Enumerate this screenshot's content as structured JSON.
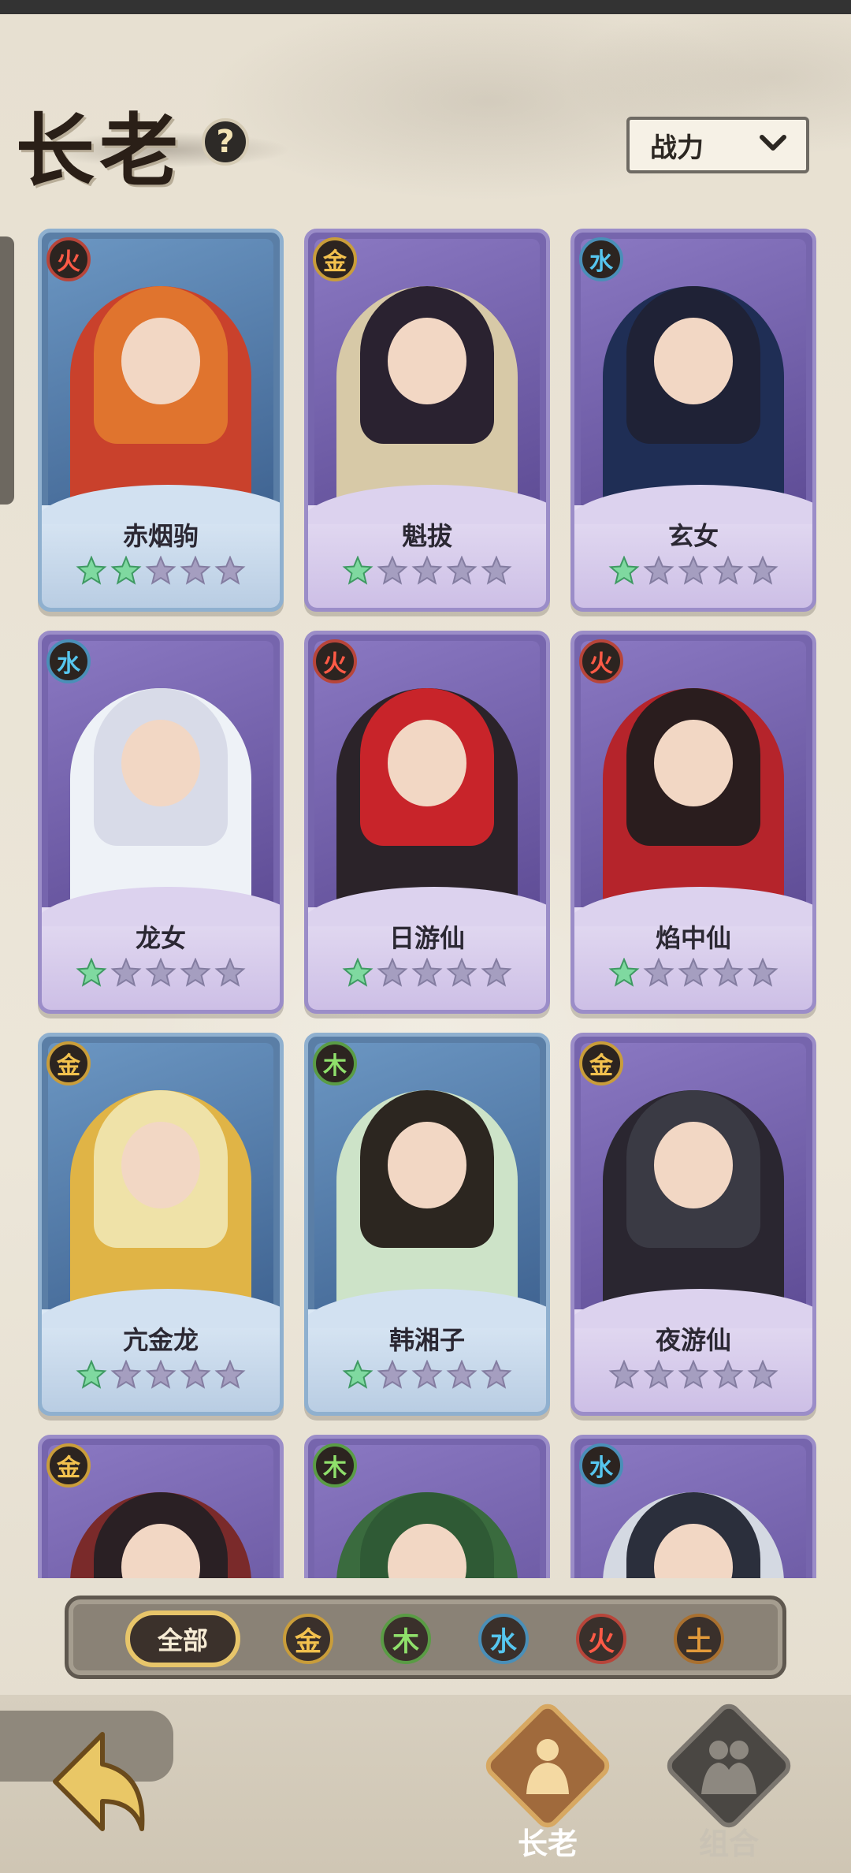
{
  "header": {
    "title": "长老",
    "sort_label": "战力"
  },
  "colors": {
    "fire": "#ff5a46",
    "metal": "#f2c14e",
    "water": "#56c6ef",
    "wood": "#8fe06b",
    "earth": "#e39a3a",
    "star_filled": "#7fd9a0",
    "star_empty": "#a59ec0"
  },
  "heroes": [
    {
      "name": "赤烟驹",
      "element": "火",
      "stars": 2,
      "theme": "blue"
    },
    {
      "name": "魁拔",
      "element": "金",
      "stars": 1,
      "theme": "purple"
    },
    {
      "name": "玄女",
      "element": "水",
      "stars": 1,
      "theme": "purple"
    },
    {
      "name": "龙女",
      "element": "水",
      "stars": 1,
      "theme": "purple"
    },
    {
      "name": "日游仙",
      "element": "火",
      "stars": 1,
      "theme": "purple"
    },
    {
      "name": "焰中仙",
      "element": "火",
      "stars": 1,
      "theme": "purple"
    },
    {
      "name": "亢金龙",
      "element": "金",
      "stars": 1,
      "theme": "blue"
    },
    {
      "name": "韩湘子",
      "element": "木",
      "stars": 1,
      "theme": "blue"
    },
    {
      "name": "夜游仙",
      "element": "金",
      "stars": 0,
      "theme": "purple"
    },
    {
      "name": "",
      "element": "金",
      "stars": 0,
      "theme": "purple"
    },
    {
      "name": "",
      "element": "木",
      "stars": 0,
      "theme": "purple"
    },
    {
      "name": "",
      "element": "水",
      "stars": 0,
      "theme": "purple"
    }
  ],
  "filters": {
    "all_label": "全部",
    "elements": [
      "金",
      "木",
      "水",
      "火",
      "土"
    ]
  },
  "nav": {
    "elders_label": "长老",
    "group_label": "组合"
  }
}
